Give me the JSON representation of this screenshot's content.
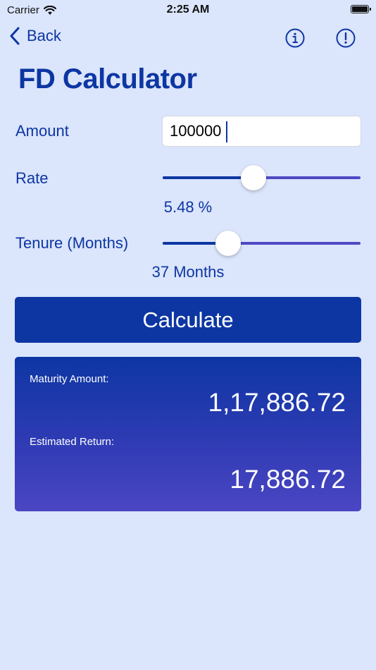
{
  "status_bar": {
    "carrier": "Carrier",
    "time": "2:25 AM"
  },
  "nav": {
    "back_label": "Back",
    "icons": [
      "info-icon",
      "alert-icon"
    ]
  },
  "title": "FD Calculator",
  "amount": {
    "label": "Amount",
    "value": "100000"
  },
  "rate": {
    "label": "Rate",
    "value_text": "5.48 %",
    "position_fraction": 0.46
  },
  "tenure": {
    "label": "Tenure (Months)",
    "value_text": "37 Months",
    "position_fraction": 0.33
  },
  "calculate_label": "Calculate",
  "results": {
    "maturity_label": "Maturity Amount:",
    "maturity_value": "1,17,886.72",
    "return_label": "Estimated Return:",
    "return_value": "17,886.72"
  },
  "colors": {
    "background": "#dbe5fb",
    "primary": "#0d36a3",
    "slider_track": "#4e49c4",
    "card_gradient_end": "#4b46c3"
  }
}
